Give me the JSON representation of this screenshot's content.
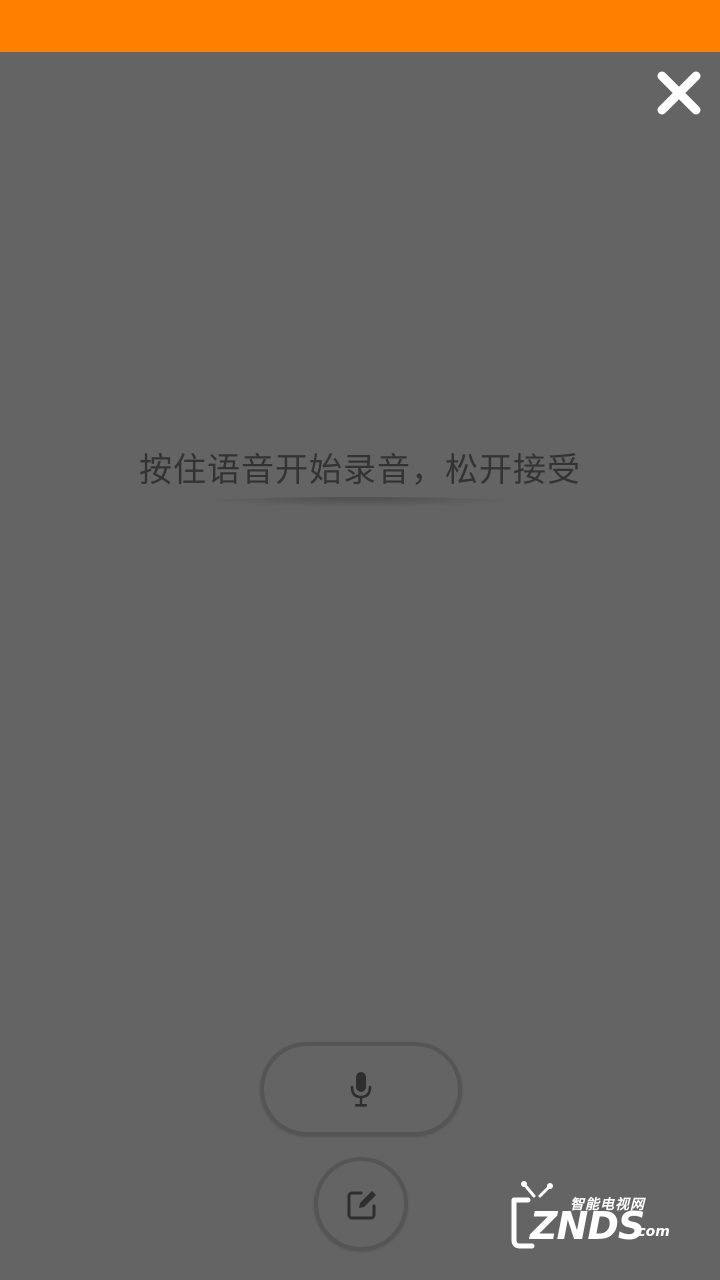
{
  "status_bar": {
    "color": "#ff7f00"
  },
  "overlay": {
    "background": "#646464"
  },
  "close_button": {
    "icon": "close-icon"
  },
  "hint": {
    "text": "按住语音开始录音，松开接受"
  },
  "mic_button": {
    "icon": "microphone-icon"
  },
  "edit_button": {
    "icon": "edit-icon"
  },
  "watermark": {
    "top_text": "智能电视网",
    "main_text": "ZNDS",
    "suffix_text": ".com"
  }
}
